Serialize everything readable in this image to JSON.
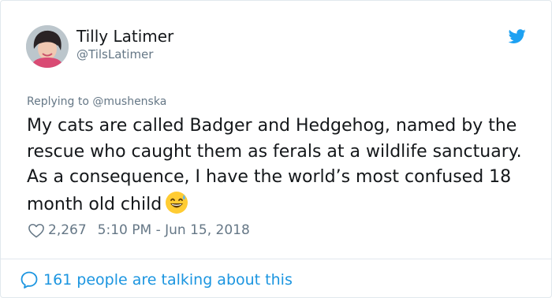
{
  "tweet": {
    "author_name": "Tilly Latimer",
    "author_handle": "@TilsLatimer",
    "replying_prefix": "Replying to",
    "replying_to": "@mushenska",
    "text": "My cats are called Badger and Hedgehog, named by the rescue who caught them as ferals at a wildlife sanctuary. As a consequence, I have the world’s most confused 18 month old child",
    "emoji": "grinning-sweat-face",
    "likes": "2,267",
    "timestamp": "5:10 PM - Jun 15, 2018",
    "talking": "161 people are talking about this"
  },
  "icons": {
    "brand": "twitter-bird-icon",
    "like": "heart-outline-icon",
    "talk": "speech-bubble-icon"
  },
  "colors": {
    "twitter_blue": "#1da1f2",
    "link_blue": "#1b95e0",
    "text": "#14171a",
    "secondary": "#657786",
    "border": "#e1e8ed"
  }
}
